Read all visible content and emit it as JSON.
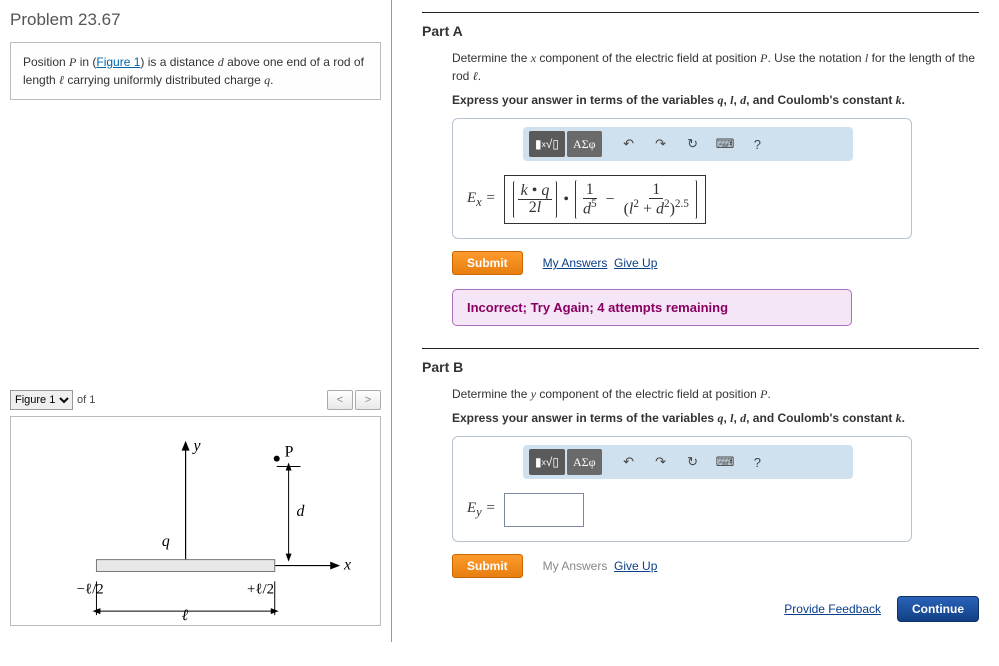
{
  "problem": {
    "title": "Problem 23.67",
    "intro_prefix": "Position ",
    "intro_mid1": " in (",
    "figure_link": "Figure 1",
    "intro_mid2": ") is a distance ",
    "intro_mid3": " above one end of a rod of length ",
    "intro_mid4": " carrying uniformly distributed charge ",
    "intro_end": "."
  },
  "figure": {
    "select_label": "Figure 1",
    "of_text": "of 1"
  },
  "partA": {
    "title": "Part A",
    "prompt_prefix": "Determine the ",
    "prompt_mid1": " component of the electric field at position ",
    "prompt_mid2": ". Use the notation ",
    "prompt_mid3": " for the length of the rod ",
    "prompt_end": ".",
    "express": "Express your answer in terms of the variables q, l, d, and Coulomb's constant k.",
    "eq_label": "Eₓ =",
    "toolbar": {
      "sym": "ΑΣφ",
      "help": "?"
    },
    "submit": "Submit",
    "my_answers": "My Answers",
    "give_up": "Give Up",
    "feedback": "Incorrect; Try Again; 4 attempts remaining"
  },
  "partB": {
    "title": "Part B",
    "prompt_prefix": "Determine the ",
    "prompt_mid1": " component of the electric field at position ",
    "prompt_end": ".",
    "express": "Express your answer in terms of the variables q, l, d, and Coulomb's constant k.",
    "eq_label": "E_y =",
    "submit": "Submit",
    "my_answers": "My Answers",
    "give_up": "Give Up"
  },
  "footer": {
    "feedback_link": "Provide Feedback",
    "continue": "Continue"
  }
}
